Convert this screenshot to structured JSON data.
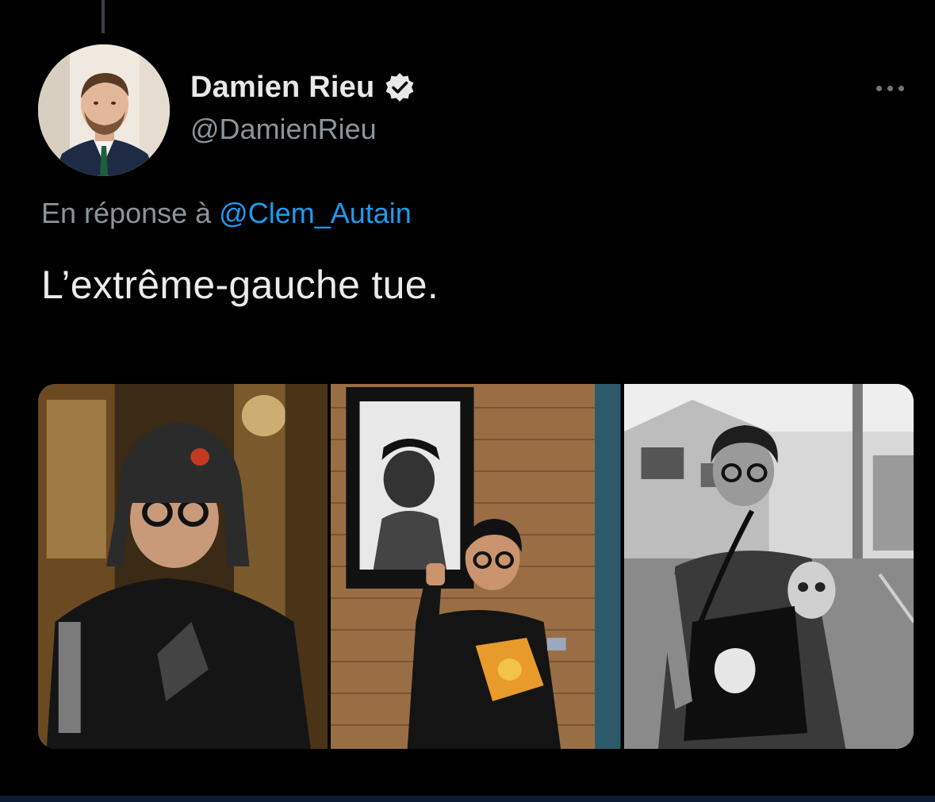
{
  "tweet": {
    "author": {
      "name": "Damien Rieu",
      "handle": "@DamienRieu",
      "verified": true
    },
    "reply_prefix": "En réponse à",
    "reply_to": "@Clem_Autain",
    "text": "L’extrême-gauche tue.",
    "media": [
      {
        "label": "photo-1"
      },
      {
        "label": "photo-2"
      },
      {
        "label": "photo-3"
      }
    ]
  },
  "colors": {
    "background": "#000000",
    "name": "#e8e8e8",
    "secondary": "#8b949b",
    "link": "#1d9bf0",
    "body_text": "#ebebeb"
  },
  "icons": {
    "verified": "verified-badge-icon",
    "more": "more-options-icon"
  }
}
